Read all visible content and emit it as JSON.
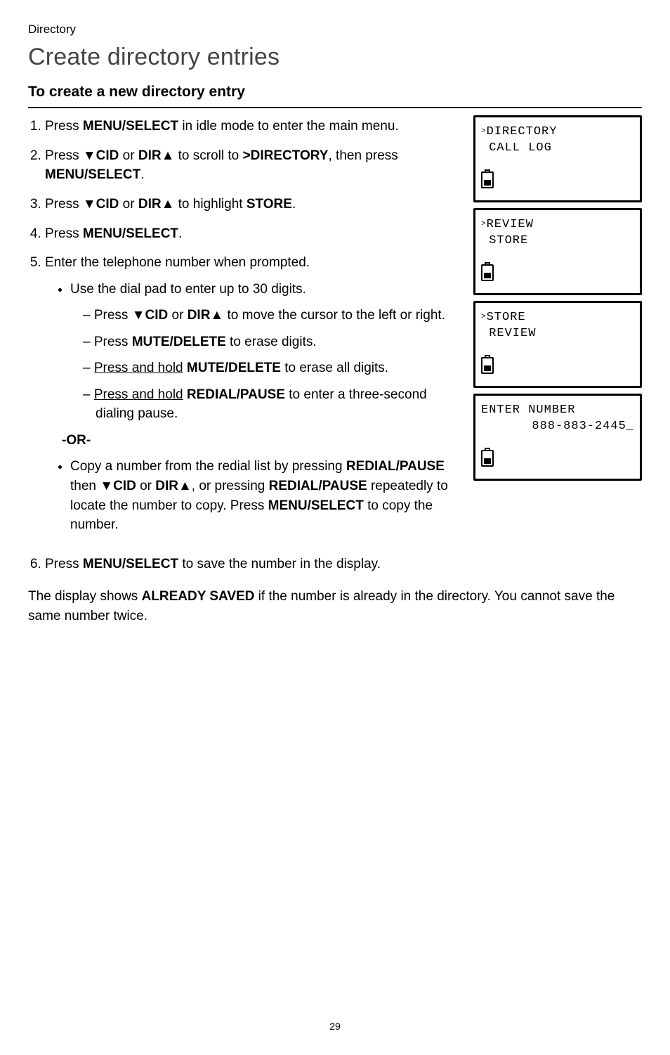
{
  "breadcrumb": "Directory",
  "title": "Create directory entries",
  "section_heading": "To create a new directory entry",
  "steps": {
    "s1": {
      "prefix": "Press ",
      "key": "MENU/",
      "key_small": "SELECT",
      "suffix": " in idle mode to enter the main menu."
    },
    "s2": {
      "text_a": "Press ",
      "cid": "▼CID",
      "text_b": " or ",
      "dir": "DIR▲",
      "text_c": " to scroll to ",
      "target": ">DIRECTORY",
      "text_d": ", then press ",
      "menu_small": "MENU",
      "select": "/SELECT",
      "text_e": "."
    },
    "s3": {
      "text_a": "Press ",
      "cid": "▼CID",
      "text_b": " or ",
      "dir": "DIR▲",
      "text_c": " to highlight ",
      "target": "STORE",
      "text_d": "."
    },
    "s4": {
      "text_a": "Press ",
      "menu_small": "MENU",
      "select": "/SELECT",
      "text_b": "."
    },
    "s5": {
      "lead": "Enter the telephone number when prompted.",
      "bullet1": "Use the dial pad to enter up to 30 digits.",
      "d1_a": "Press ",
      "d1_cid": "▼CID",
      "d1_b": " or ",
      "d1_dir": "DIR▲",
      "d1_c": " to move the cursor to the left or right.",
      "d2_a": "Press ",
      "d2_key_small": "MUTE",
      "d2_key": "/DELETE",
      "d2_b": " to erase digits.",
      "d3_a": "Press and hold",
      "d3_b": " ",
      "d3_key_small": "MUTE",
      "d3_key": "/DELETE",
      "d3_c": " to erase all digits.",
      "d4_a": "Press and hold",
      "d4_b": " ",
      "d4_key_small": "REDIAL",
      "d4_key": "/PAUSE",
      "d4_c": " to enter a three-second dialing pause.",
      "or": "-OR-",
      "b2_a": "Copy a number from the redial list by pressing ",
      "b2_redial": "REDIAL/",
      "b2_pause_small": "PAUSE",
      "b2_b": " then ",
      "b2_cid": "▼CID",
      "b2_c": " or ",
      "b2_dir": "DIR▲",
      "b2_d": ", or pressing ",
      "b2_redial2": "REDIAL/",
      "b2_pause_small2": "PAUSE",
      "b2_e": " repeatedly to locate the number to copy. Press ",
      "b2_menu_small": "MENU",
      "b2_select": "/SELECT",
      "b2_f": " to copy the number."
    },
    "s6": {
      "text_a": "Press ",
      "menu_small": "MENU",
      "select": "/SELECT",
      "text_b": " to save the number in the display."
    }
  },
  "after_text_a": "The display shows ",
  "after_key": "ALREADY SAVED",
  "after_text_b": " if the number is already in the directory. You cannot save the same number twice.",
  "lcd1": {
    "line1": "DIRECTORY",
    "line2": " CALL LOG"
  },
  "lcd2": {
    "line1": "REVIEW",
    "line2": " STORE"
  },
  "lcd3": {
    "line1": "STORE",
    "line2": " REVIEW"
  },
  "lcd4": {
    "line1": "ENTER NUMBER",
    "line2": "888-883-2445_"
  },
  "page_number": "29"
}
